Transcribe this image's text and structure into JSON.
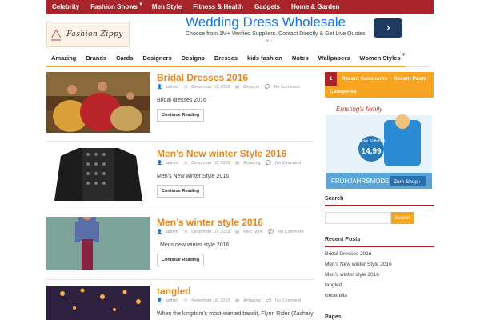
{
  "topnav": {
    "items": [
      "Celebrity",
      "Fashion Shows",
      "Men Style",
      "Fitness & Health",
      "Gadgets",
      "Home & Garden"
    ]
  },
  "logo": {
    "text": "Fashion Zippy"
  },
  "ad": {
    "headline": "Wedding Dress Wholesale",
    "sub": "Choose from 1M+ Verified Suppliers. Contact Directly & Get Live Quotes!",
    "arrow": "›",
    "dots": "●  ○"
  },
  "catnav": {
    "items": [
      "Amazing",
      "Brands",
      "Cards",
      "Designers",
      "Designs",
      "Dresses",
      "kids fashion",
      "Notes",
      "Wallpapers",
      "Women Styles"
    ]
  },
  "posts": [
    {
      "title": "Bridal Dresses 2016",
      "author": "admin",
      "date": "December 10, 2015",
      "category": "Designs",
      "comments": "No Comment",
      "excerpt": "Bridal dresses 2016",
      "button": "Continue Reading"
    },
    {
      "title": "Men’s New winter Style 2016",
      "author": "admin",
      "date": "December 10, 2015",
      "category": "Amazing",
      "comments": "No Comment",
      "excerpt": "Men’s New winter Style 2016",
      "button": "Continue Reading"
    },
    {
      "title": "Men’s winter style 2016",
      "author": "admin",
      "date": "December 10, 2015",
      "category": "Men Style",
      "comments": "No Comment",
      "excerpt": "Mens new winter style 2016",
      "button": "Continue Reading"
    },
    {
      "title": "tangled",
      "author": "admin",
      "date": "November 16, 2015",
      "category": "Amazing",
      "comments": "No Comment",
      "excerpt": "When the kingdom’s most-wanted bandit, Flynn Rider (Zachary",
      "button": ""
    }
  ],
  "sidebar": {
    "tabs": {
      "num": "1",
      "recent_comments": "Recent Comments",
      "recent_posts": "Recent Posts",
      "categories": "Categories"
    },
    "ad": {
      "brand": "Ernsting's family",
      "product": "Jacke Softshell",
      "price": "14,99",
      "slogan": "FRÜHJAHRSMODE",
      "cta": "Zum Shop ›"
    },
    "search": {
      "title": "Search",
      "button": "Search",
      "placeholder": ""
    },
    "recent": {
      "title": "Recent Posts",
      "items": [
        "Bridal Dresses 2016",
        "Men’s New winter Style 2016",
        "Men’s winter style 2016",
        "tangled",
        "cinderella"
      ]
    },
    "pages": {
      "title": "Pages"
    }
  }
}
